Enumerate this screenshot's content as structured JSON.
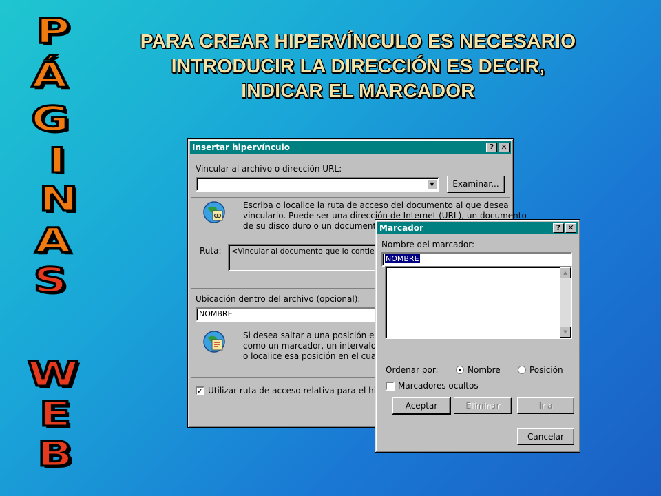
{
  "slide": {
    "title": "PARA CREAR HIPERVÍNCULO ES NECESARIO INTRODUCIR LA DIRECCIÓN ES DECIR, INDICAR EL MARCADOR",
    "vertical_letters": [
      "P",
      "Á",
      "G",
      "I",
      "N",
      "A",
      "S",
      "W",
      "E",
      "B"
    ],
    "colors": {
      "background_top": "#1fc6d0",
      "background_bottom": "#1a5fc4",
      "title": "#f2e4a8",
      "letters": "#f07a10"
    }
  },
  "insert_dialog": {
    "title": "Insertar hipervínculo",
    "help_btn": "?",
    "close_btn": "✕",
    "url_label": "Vincular al archivo o dirección URL:",
    "url_value": "",
    "browse_button": "Examinar...",
    "info1_line1": "Escriba o localice la ruta de acceso del documento al que desea",
    "info1_line2": "vincularlo. Puede ser una dirección de Internet (URL), un documento",
    "info1_line3": "de su disco duro o un documento de",
    "path_label": "Ruta:",
    "path_value": "<Vincular al documento que lo contien",
    "location_label": "Ubicación dentro del archivo (opcional):",
    "location_value": "NOMBRE",
    "info2_line1": "Si desea saltar a una posición espe",
    "info2_line2": "como un marcador, un intervalo o u",
    "info2_line3": "o localice esa posición en el cuadro",
    "relative_path_label": "Utilizar ruta de acceso relativa para el hiper",
    "relative_path_checked": true
  },
  "bookmark_dialog": {
    "title": "Marcador",
    "help_btn": "?",
    "close_btn": "✕",
    "name_label": "Nombre del marcador:",
    "name_value": "NOMBRE",
    "sort_label": "Ordenar por:",
    "sort_name": "Nombre",
    "sort_position": "Posición",
    "sort_selected": "Nombre",
    "hidden_label": "Marcadores ocultos",
    "hidden_checked": false,
    "accept_button": "Aceptar",
    "delete_button": "Eliminar",
    "goto_button": "Ir a",
    "cancel_button": "Cancelar"
  }
}
